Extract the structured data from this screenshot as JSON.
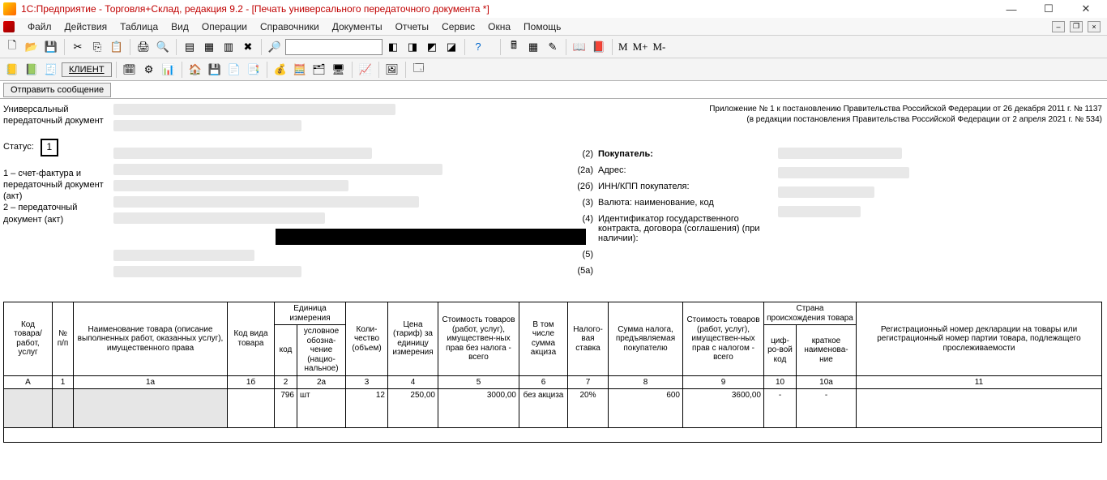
{
  "title": "1С:Предприятие - Торговля+Склад, редакция 9.2 - [Печать универсального передаточного документа  *]",
  "menu": [
    "Файл",
    "Действия",
    "Таблица",
    "Вид",
    "Операции",
    "Справочники",
    "Документы",
    "Отчеты",
    "Сервис",
    "Окна",
    "Помощь"
  ],
  "toolbar_m": {
    "m": "M",
    "mplus": "M+",
    "mminus": "M-"
  },
  "client_label": "КЛИЕНТ",
  "msg_btn": "Отправить сообщение",
  "sidebar": {
    "title": "Универсальный передаточный документ",
    "status_label": "Статус:",
    "status_value": "1",
    "note": "1 – счет-фактура и передаточный документ (акт)\n2 – передаточный документ (акт)"
  },
  "header_right": {
    "line1": "Приложение № 1 к постановлению Правительства Российской Федерации от 26 декабря 2011 г. № 1137",
    "line2": "(в редакции постановления Правительства Российской Федерации от 2 апреля 2021 г. № 534)"
  },
  "fields": {
    "r2": {
      "idx": "(2)",
      "label": "Покупатель:"
    },
    "r2a": {
      "idx": "(2а)",
      "label": "Адрес:"
    },
    "r2b": {
      "idx": "(2б)",
      "label": "ИНН/КПП покупателя:"
    },
    "r3": {
      "idx": "(3)",
      "label": "Валюта: наименование, код"
    },
    "r4": {
      "idx": "(4)",
      "label": "Идентификатор государственного контракта, договора (соглашения) (при наличии):"
    },
    "r5": {
      "idx": "(5)",
      "label": ""
    },
    "r5a": {
      "idx": "(5а)",
      "label": ""
    }
  },
  "table": {
    "headers": {
      "h1": "Код товара/ работ, услуг",
      "h2": "№ п/п",
      "h3": "Наименование товара (описание выполненных работ, оказанных услуг), имущественного права",
      "h4": "Код вида товара",
      "h5": "Единица измерения",
      "h5a": "код",
      "h5b": "условное обозна-чение (нацио-нальное)",
      "h6": "Коли-чество (объем)",
      "h7": "Цена (тариф) за единицу измерения",
      "h8": "Стоимость товаров (работ, услуг), имуществен-ных прав без налога - всего",
      "h9": "В том числе сумма акциза",
      "h10": "Налого-вая ставка",
      "h11": "Сумма налога, предъявляемая покупателю",
      "h12": "Стоимость товаров (работ, услуг), имуществен-ных прав с налогом - всего",
      "h13": "Страна происхождения товара",
      "h13a": "циф-ро-вой код",
      "h13b": "краткое наименова-ние",
      "h14": "Регистрационный номер декларации на товары или регистрационный номер партии товара, подлежащего прослеживаемости"
    },
    "index_row": [
      "А",
      "1",
      "1а",
      "1б",
      "2",
      "2а",
      "3",
      "4",
      "5",
      "6",
      "7",
      "8",
      "9",
      "10",
      "10а",
      "11"
    ],
    "data_row": {
      "code": "796",
      "unit": "шт",
      "qty": "12",
      "price": "250,00",
      "sum_no_tax": "3000,00",
      "excise": "без акциза",
      "rate": "20%",
      "tax": "600",
      "sum_tax": "3600,00",
      "country_code": "-",
      "country_name": "-"
    }
  }
}
